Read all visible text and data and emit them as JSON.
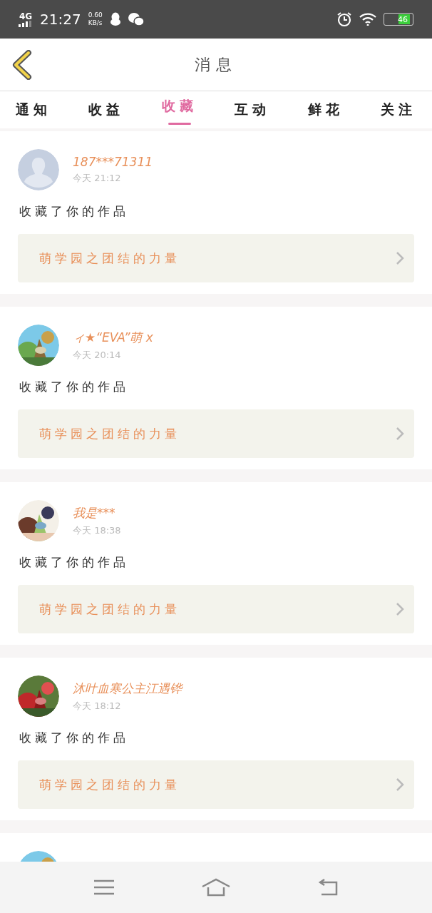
{
  "status_bar": {
    "network": "4G",
    "time": "21:27",
    "speed": "0.60",
    "speed_unit": "KB/s",
    "battery": "46"
  },
  "header": {
    "title": "消息"
  },
  "tabs": [
    {
      "label": "通知",
      "selected": false
    },
    {
      "label": "收益",
      "selected": false
    },
    {
      "label": "收藏",
      "selected": true
    },
    {
      "label": "互动",
      "selected": false
    },
    {
      "label": "鲜花",
      "selected": false
    },
    {
      "label": "关注",
      "selected": false
    }
  ],
  "messages": [
    {
      "kind": "full",
      "avatar": {
        "kind": "default"
      },
      "name": "187***71311",
      "time": "今天 21:12",
      "action": "收藏了你的作品",
      "work_title": "萌学园之团结的力量"
    },
    {
      "kind": "full",
      "name": "ィ★“EVA”萌 x",
      "time": "今天 20:14",
      "action": "收藏了你的作品",
      "work_title": "萌学园之团结的力量"
    },
    {
      "kind": "full",
      "name": "我是***",
      "time": "今天 18:38",
      "action": "收藏了你的作品",
      "work_title": "萌学园之团结的力量"
    },
    {
      "kind": "full",
      "name": "沐叶血寒公主江遇铧",
      "time": "今天 18:12",
      "action": "收藏了你的作品",
      "work_title": "萌学园之团结的力量"
    },
    {
      "kind": "partial"
    }
  ]
}
